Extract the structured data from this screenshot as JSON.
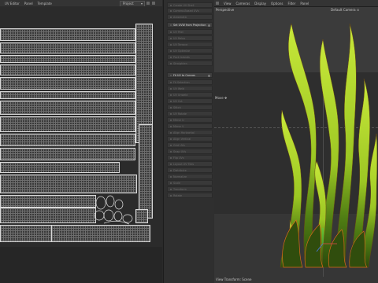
{
  "uv_editor": {
    "menu": [
      "UV Editor",
      "Panel",
      "Template"
    ],
    "dropdown": "Project"
  },
  "sidebar": {
    "items": [
      {
        "label": "Create UV Shell",
        "active": false
      },
      {
        "label": "Camera-Based UVs",
        "active": false
      },
      {
        "label": "Automatic",
        "active": false
      },
      {
        "label": "Set UVW from Projection",
        "active": true,
        "dot": true
      },
      {
        "label": "UV Peel",
        "active": false
      },
      {
        "label": "UV Relax",
        "active": false
      },
      {
        "label": "UV Terrace",
        "active": false
      },
      {
        "label": "UV Optimize",
        "active": false
      },
      {
        "label": "Pack Islands",
        "active": false
      },
      {
        "label": "Straighten",
        "active": false
      },
      {
        "label": "Fit UV to Canvas",
        "active": true,
        "dot": true
      },
      {
        "label": "Fit Selection",
        "active": false
      },
      {
        "label": "UV Weld",
        "active": false
      },
      {
        "label": "UV Unweld",
        "active": false
      },
      {
        "label": "UV Cut",
        "active": false
      },
      {
        "label": "Stitch",
        "active": false
      },
      {
        "label": "UV Rotate",
        "active": false
      },
      {
        "label": "Mirror U",
        "active": false
      },
      {
        "label": "Mirror V",
        "active": false
      },
      {
        "label": "Align Horizontal",
        "active": false
      },
      {
        "label": "Align Vertical",
        "active": false
      },
      {
        "label": "Grid UVs",
        "active": false
      },
      {
        "label": "Snap UVs",
        "active": false
      },
      {
        "label": "Flip UVs",
        "active": false
      },
      {
        "label": "Layout UV Tiles",
        "active": false
      },
      {
        "label": "Distribute",
        "active": false
      },
      {
        "label": "Normalize",
        "active": false
      },
      {
        "label": "Scale",
        "active": false
      },
      {
        "label": "Transform",
        "active": false
      },
      {
        "label": "Rotate",
        "active": false
      }
    ]
  },
  "viewport": {
    "menu": [
      "View",
      "Cameras",
      "Display",
      "Options",
      "Filter",
      "Panel"
    ],
    "perspective": "Perspective",
    "camera": "Default Camera",
    "move_label": "Move",
    "status": "View Transform: Scene"
  },
  "colors": {
    "grass_light": "#b9e02c",
    "grass_dark": "#3a5410",
    "selection_orange": "#d96a1a"
  }
}
